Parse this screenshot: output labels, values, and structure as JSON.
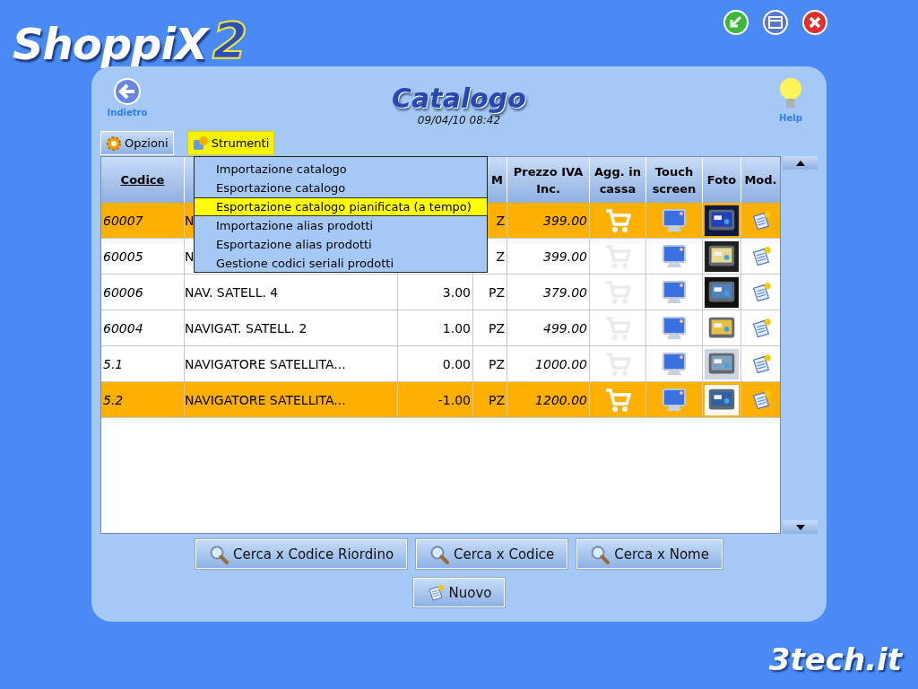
{
  "app": {
    "logo": "ShoppiX",
    "logo_version": "2",
    "footer_brand": "3tech.it"
  },
  "header": {
    "back_label": "Indietro",
    "title": "Catalogo",
    "datetime": "09/04/10 08:42",
    "help_label": "Help"
  },
  "toolbar": [
    {
      "label": "Opzioni",
      "selected": false
    },
    {
      "label": "Strumenti",
      "selected": true
    }
  ],
  "menu": [
    {
      "label": "Importazione catalogo",
      "selected": false
    },
    {
      "label": "Esportazione catalogo",
      "selected": false
    },
    {
      "label": "Esportazione catalogo pianificata (a tempo)",
      "selected": true
    },
    {
      "label": "Importazione alias prodotti",
      "selected": false
    },
    {
      "label": "Esportazione alias prodotti",
      "selected": false
    },
    {
      "label": "Gestione codici seriali prodotti",
      "selected": false
    }
  ],
  "table": {
    "columns": [
      {
        "label": "Codice"
      },
      {},
      {},
      {
        "label": "M"
      },
      {
        "label": "Prezzo IVA Inc."
      },
      {
        "label": "Agg. in cassa"
      },
      {
        "label": "Touch screen"
      },
      {
        "label": "Foto"
      },
      {
        "label": "Mod."
      }
    ],
    "rows": [
      {
        "code": "60007",
        "description": "N",
        "um": "Z",
        "price": "399.00",
        "in_cassa": true,
        "selected": true
      },
      {
        "code": "60005",
        "description": "N",
        "um": "Z",
        "price": "399.00",
        "in_cassa": false,
        "selected": false
      },
      {
        "code": "60006",
        "description": "NAV. SATELL. 4",
        "qty": "3.00",
        "um": "PZ",
        "price": "379.00",
        "in_cassa": false,
        "selected": false
      },
      {
        "code": "60004",
        "description": "NAVIGAT. SATELL. 2",
        "qty": "1.00",
        "um": "PZ",
        "price": "499.00",
        "in_cassa": false,
        "selected": false
      },
      {
        "code": "5.1",
        "description": "NAVIGATORE SATELLITA...",
        "qty": "0.00",
        "um": "PZ",
        "price": "1000.00",
        "in_cassa": false,
        "selected": false
      },
      {
        "code": "5.2",
        "description": "NAVIGATORE SATELLITA...",
        "qty": "-1.00",
        "um": "PZ",
        "price": "1200.00",
        "in_cassa": true,
        "selected": true
      }
    ]
  },
  "search_buttons": [
    "Cerca x Codice Riordino",
    "Cerca x Codice",
    "Cerca x Nome"
  ],
  "new_button": "Nuovo"
}
